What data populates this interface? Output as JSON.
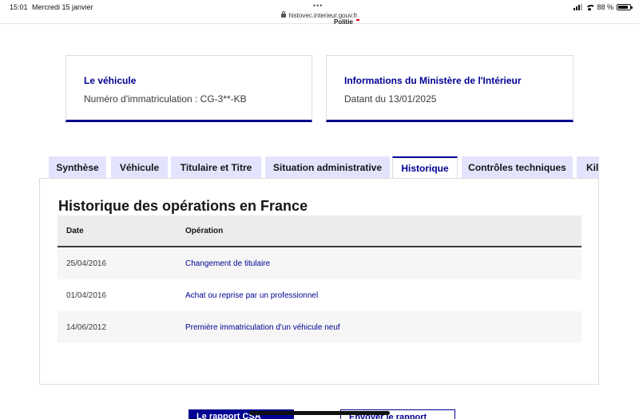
{
  "status_bar": {
    "time": "15:01",
    "date": "Mercredi 15 janvier",
    "url": "histovec.interieur.gouv.fr",
    "battery": "88 %",
    "battery_level": 0.88,
    "icons": [
      "signal-icon",
      "wifi-icon",
      "battery-icon",
      "lock-icon"
    ]
  },
  "header": {
    "logo_fragment": "Politie"
  },
  "cards": {
    "vehicle": {
      "title": "Le véhicule",
      "text": "Numéro d'immatriculation : CG-3**-KB"
    },
    "ministry": {
      "title": "Informations du Ministère de l'Intérieur",
      "text": "Datant du 13/01/2025"
    }
  },
  "tabs": [
    {
      "label": "Synthèse",
      "active": false
    },
    {
      "label": "Véhicule",
      "active": false
    },
    {
      "label": "Titulaire et Titre",
      "active": false
    },
    {
      "label": "Situation administrative",
      "active": false
    },
    {
      "label": "Historique",
      "active": true
    },
    {
      "label": "Contrôles techniques",
      "active": false
    },
    {
      "label": "Kilo",
      "active": false
    }
  ],
  "history": {
    "title": "Historique des opérations en France",
    "columns": {
      "date": "Date",
      "operation": "Opération"
    },
    "rows": [
      {
        "date": "25/04/2016",
        "operation": "Changement de titulaire"
      },
      {
        "date": "01/04/2016",
        "operation": "Achat ou reprise par un professionnel"
      },
      {
        "date": "14/06/2012",
        "operation": "Première immatriculation d'un véhicule neuf"
      }
    ]
  },
  "footer_buttons": {
    "primary": "Le rapport CSA",
    "secondary": "Envoyer le rapport"
  },
  "colors": {
    "primary": "#000091",
    "tab_background": "#e3e3fd",
    "row_alt": "#f6f6f6",
    "header_row": "#ececec"
  }
}
